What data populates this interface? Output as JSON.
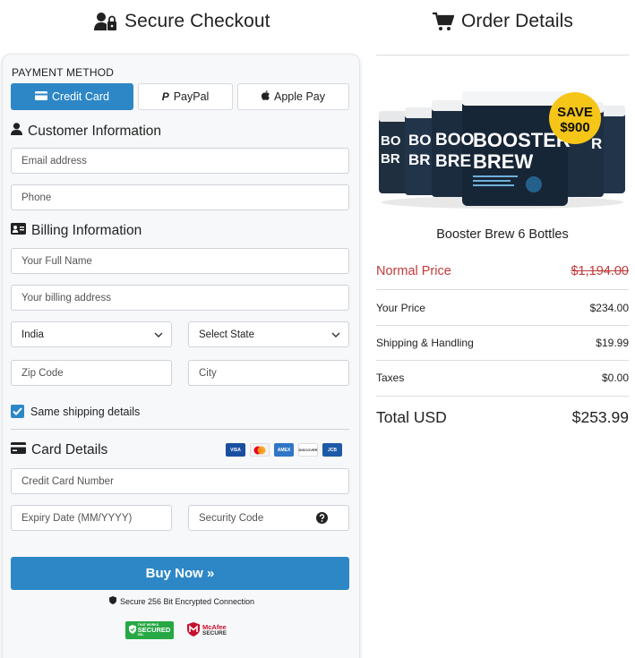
{
  "headers": {
    "left_title": "Secure Checkout",
    "right_title": "Order Details"
  },
  "payment": {
    "label": "PAYMENT METHOD",
    "methods": [
      {
        "label": "Credit Card",
        "active": true
      },
      {
        "label": "PayPal",
        "active": false
      },
      {
        "label": "Apple Pay",
        "active": false
      }
    ]
  },
  "customer": {
    "heading": "Customer Information",
    "email_placeholder": "Email address",
    "phone_placeholder": "Phone"
  },
  "billing": {
    "heading": "Billing Information",
    "name_placeholder": "Your Full Name",
    "address_placeholder": "Your billing address",
    "country_value": "India",
    "state_value": "Select State",
    "zip_placeholder": "Zip Code",
    "city_placeholder": "City",
    "same_shipping_label": "Same shipping details",
    "same_shipping_checked": true
  },
  "card": {
    "heading": "Card Details",
    "logos": [
      "VISA",
      "MC",
      "AMEX",
      "DISCOVER",
      "JCB"
    ],
    "number_placeholder": "Credit Card Number",
    "expiry_placeholder": "Expiry Date (MM/YYYY)",
    "cvv_placeholder": "Security Code"
  },
  "actions": {
    "buy_label": "Buy Now »",
    "secure_note": "Secure 256 Bit Encrypted Connection",
    "badges": [
      {
        "top": "THAT WORKS",
        "main": "SECURED",
        "bottom": "SSL"
      },
      {
        "main": "McAfee",
        "sub": "SECURE"
      }
    ]
  },
  "order": {
    "product_name": "Booster Brew 6 Bottles",
    "jar_brand": "BOOSTER",
    "jar_brand2": "BREW",
    "save_line1": "SAVE",
    "save_line2": "$900",
    "normal_price_label": "Normal Price",
    "normal_price_value": "$1,194.00",
    "your_price_label": "Your Price",
    "your_price_value": "$234.00",
    "shipping_label": "Shipping & Handling",
    "shipping_value": "$19.99",
    "taxes_label": "Taxes",
    "taxes_value": "$0.00",
    "total_label": "Total USD",
    "total_value": "$253.99"
  },
  "colors": {
    "accent": "#2d87c6",
    "strike_red": "#c23a3a",
    "save_badge": "#f5c518"
  }
}
